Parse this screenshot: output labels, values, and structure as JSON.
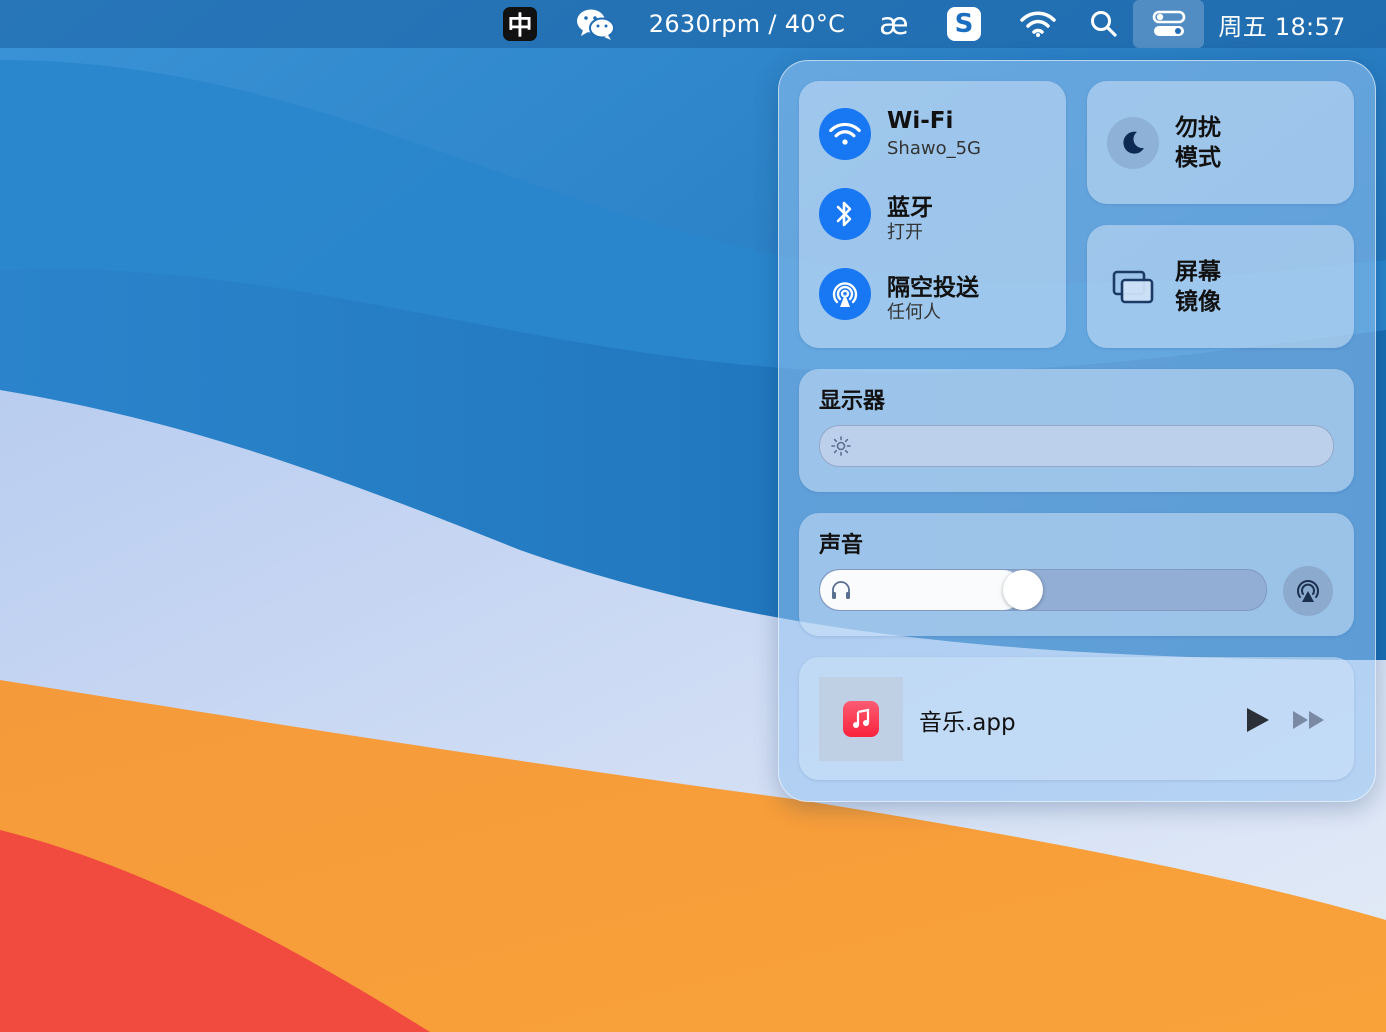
{
  "menubar": {
    "ime_label": "中",
    "wechat_icon": "wechat-icon",
    "fan_temp": "2630rpm / 40°C",
    "ae_label": "æ",
    "s_app_label": "S",
    "wifi_icon": "wifi-icon",
    "search_icon": "search-icon",
    "control_center_icon": "control-center-icon",
    "clock": "周五 18:57"
  },
  "control_center": {
    "connectivity": {
      "wifi": {
        "title": "Wi-Fi",
        "subtitle": "Shawo_5G",
        "icon": "wifi-icon",
        "color": "#1877f2"
      },
      "bluetooth": {
        "title": "蓝牙",
        "subtitle": "打开",
        "icon": "bluetooth-icon",
        "color": "#1877f2"
      },
      "airdrop": {
        "title": "隔空投送",
        "subtitle": "任何人",
        "icon": "airdrop-icon",
        "color": "#1877f2"
      }
    },
    "do_not_disturb": {
      "line1": "勿扰",
      "line2": "模式",
      "icon": "moon-icon"
    },
    "screen_mirroring": {
      "line1": "屏幕",
      "line2": "镜像",
      "icon": "screen-mirroring-icon"
    },
    "display": {
      "title": "显示器",
      "brightness": 0.0,
      "icon": "sun-icon"
    },
    "sound": {
      "title": "声音",
      "volume": 0.45,
      "icon": "headphones-icon",
      "airplay_icon": "airplay-audio-icon"
    },
    "now_playing": {
      "app": "音乐.app",
      "icon": "music-note-icon",
      "play_icon": "play-icon",
      "forward_icon": "fast-forward-icon"
    }
  }
}
